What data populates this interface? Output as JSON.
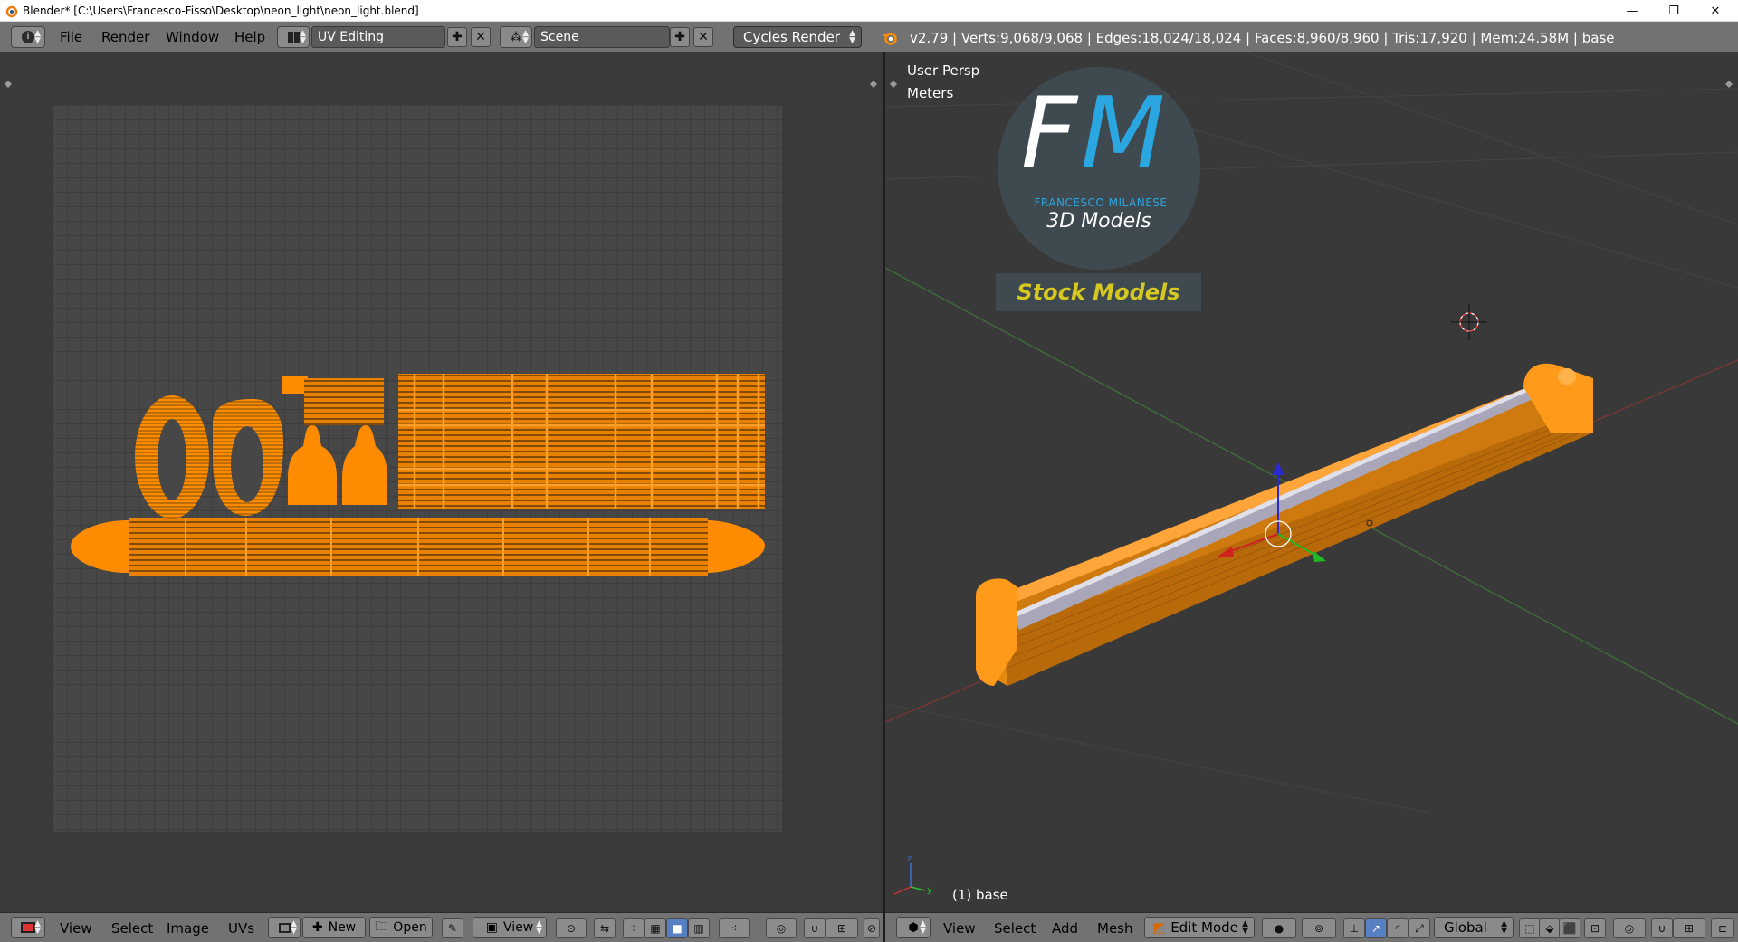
{
  "window": {
    "title": "Blender* [C:\\Users\\Francesco-Fisso\\Desktop\\neon_light\\neon_light.blend]",
    "minimize": "—",
    "maximize": "❐",
    "close": "✕"
  },
  "topbar": {
    "menus": [
      "File",
      "Render",
      "Window",
      "Help"
    ],
    "screen_layout": "UV Editing",
    "scene": "Scene",
    "render_engine": "Cycles Render",
    "stats": "v2.79 | Verts:9,068/9,068 | Edges:18,024/18,024 | Faces:8,960/8,960 | Tris:17,920 | Mem:24.58M | base"
  },
  "uv_editor": {
    "menus": [
      "View",
      "Select",
      "Image",
      "UVs"
    ],
    "new_label": "New",
    "open_label": "Open",
    "view_label": "View"
  },
  "viewport": {
    "view_name": "User Persp",
    "units": "Meters",
    "object_label": "(1) base",
    "menus": [
      "View",
      "Select",
      "Add",
      "Mesh"
    ],
    "mode": "Edit Mode",
    "orientation": "Global"
  },
  "logo": {
    "letters_f": "F",
    "letters_m": "M",
    "name": "FRANCESCO MILANESE",
    "subtitle": "3D Models",
    "banner": "Stock Models"
  },
  "colors": {
    "accent_orange": "#ff8c00",
    "logo_blue": "#2aa6e0",
    "banner_yellow": "#d6c81e"
  }
}
